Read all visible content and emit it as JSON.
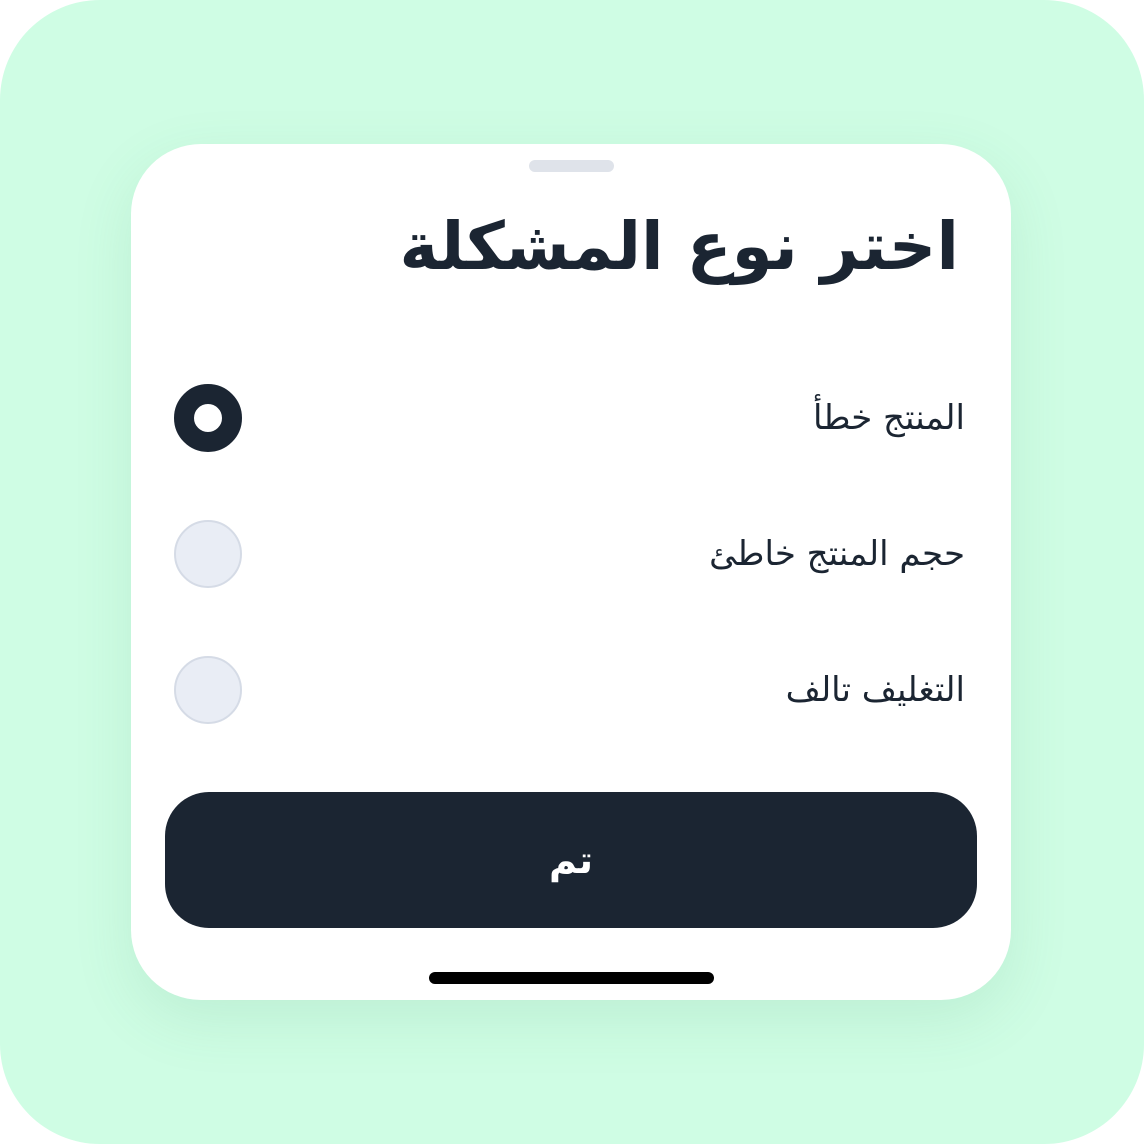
{
  "sheet": {
    "title": "اختر نوع المشكلة",
    "options": [
      {
        "label": "المنتج خطأ",
        "selected": true
      },
      {
        "label": "حجم المنتج خاطئ",
        "selected": false
      },
      {
        "label": "التغليف تالف",
        "selected": false
      }
    ],
    "done_label": "تم"
  },
  "colors": {
    "background": "#cffde4",
    "sheet": "#ffffff",
    "primary": "#1b2532",
    "radio_unselected_fill": "#e9edf5",
    "radio_unselected_border": "#d5dbe6",
    "grabber": "#dfe3ea"
  }
}
